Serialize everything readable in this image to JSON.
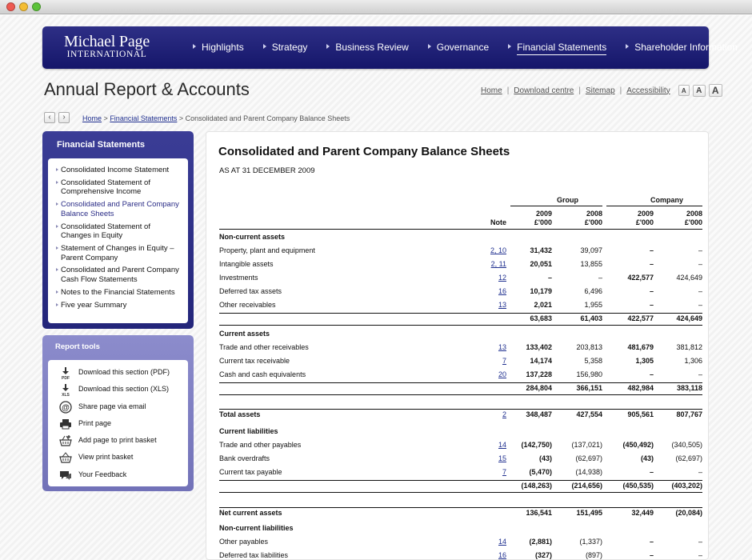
{
  "window": {
    "controls": [
      "close",
      "minimize",
      "zoom"
    ]
  },
  "logo": {
    "line1": "Michael Page",
    "line2": "INTERNATIONAL"
  },
  "nav": [
    {
      "label": "Highlights",
      "active": false
    },
    {
      "label": "Strategy",
      "active": false
    },
    {
      "label": "Business Review",
      "active": false
    },
    {
      "label": "Governance",
      "active": false
    },
    {
      "label": "Financial Statements",
      "active": true
    },
    {
      "label": "Shareholder Information",
      "active": false
    }
  ],
  "page_title": "Annual Report & Accounts",
  "util_links": [
    "Home",
    "Download centre",
    "Sitemap",
    "Accessibility"
  ],
  "font_sizes": [
    "A",
    "A",
    "A"
  ],
  "breadcrumb": {
    "home": "Home",
    "section": "Financial Statements",
    "current": "> Consolidated and Parent Company Balance Sheets",
    "sep": ">"
  },
  "sidebar": {
    "title": "Financial Statements",
    "items": [
      {
        "label": "Consolidated Income Statement",
        "active": false
      },
      {
        "label": "Consolidated Statement of Comprehensive Income",
        "active": false
      },
      {
        "label": "Consolidated and Parent Company Balance Sheets",
        "active": true
      },
      {
        "label": "Consolidated Statement of Changes in Equity",
        "active": false
      },
      {
        "label": "Statement of Changes in Equity – Parent Company",
        "active": false
      },
      {
        "label": "Consolidated and Parent Company Cash Flow Statements",
        "active": false
      },
      {
        "label": "Notes to the Financial Statements",
        "active": false
      },
      {
        "label": "Five year Summary",
        "active": false
      }
    ]
  },
  "tools": {
    "title": "Report tools",
    "items": [
      {
        "label": "Download this section (PDF)",
        "icon": "download-pdf-icon",
        "sub": "PDF"
      },
      {
        "label": "Download this section (XLS)",
        "icon": "download-xls-icon",
        "sub": "XLS"
      },
      {
        "label": "Share page via email",
        "icon": "email-icon"
      },
      {
        "label": "Print page",
        "icon": "printer-icon"
      },
      {
        "label": "Add page to print basket",
        "icon": "add-basket-icon"
      },
      {
        "label": "View print basket",
        "icon": "basket-icon"
      },
      {
        "label": "Your Feedback",
        "icon": "feedback-icon"
      }
    ]
  },
  "content": {
    "title": "Consolidated and Parent Company Balance Sheets",
    "subtitle": "AS AT 31 DECEMBER 2009",
    "group_label": "Group",
    "company_label": "Company",
    "note_header": "Note",
    "col_years": [
      "2009",
      "2008",
      "2009",
      "2008"
    ],
    "col_units": [
      "£'000",
      "£'000",
      "£'000",
      "£'000"
    ],
    "rows": [
      {
        "type": "section",
        "label": "Non-current assets"
      },
      {
        "type": "row",
        "label": "Property, plant and equipment",
        "note": "2, 10",
        "values": [
          "31,432",
          "39,097",
          "–",
          "–"
        ]
      },
      {
        "type": "row",
        "label": "Intangible assets",
        "note": "2, 11",
        "values": [
          "20,051",
          "13,855",
          "–",
          "–"
        ]
      },
      {
        "type": "row",
        "label": "Investments",
        "note": "12",
        "values": [
          "–",
          "–",
          "422,577",
          "424,649"
        ]
      },
      {
        "type": "row",
        "label": "Deferred tax assets",
        "note": "16",
        "values": [
          "10,179",
          "6,496",
          "–",
          "–"
        ]
      },
      {
        "type": "row",
        "label": "Other receivables",
        "note": "13",
        "values": [
          "2,021",
          "1,955",
          "–",
          "–"
        ]
      },
      {
        "type": "total",
        "label": "",
        "note": "",
        "values": [
          "63,683",
          "61,403",
          "422,577",
          "424,649"
        ]
      },
      {
        "type": "section",
        "label": "Current assets"
      },
      {
        "type": "row",
        "label": "Trade and other receivables",
        "note": "13",
        "values": [
          "133,402",
          "203,813",
          "481,679",
          "381,812"
        ]
      },
      {
        "type": "row",
        "label": "Current tax receivable",
        "note": "7",
        "values": [
          "14,174",
          "5,358",
          "1,305",
          "1,306"
        ]
      },
      {
        "type": "row",
        "label": "Cash and cash equivalents",
        "note": "20",
        "values": [
          "137,228",
          "156,980",
          "–",
          "–"
        ]
      },
      {
        "type": "total",
        "label": "",
        "note": "",
        "values": [
          "284,804",
          "366,151",
          "482,984",
          "383,118"
        ]
      },
      {
        "type": "grand",
        "label": "Total assets",
        "note": "2",
        "values": [
          "348,487",
          "427,554",
          "905,561",
          "807,767"
        ]
      },
      {
        "type": "section",
        "label": "Current liabilities"
      },
      {
        "type": "row",
        "label": "Trade and other payables",
        "note": "14",
        "values": [
          "(142,750)",
          "(137,021)",
          "(450,492)",
          "(340,505)"
        ]
      },
      {
        "type": "row",
        "label": "Bank overdrafts",
        "note": "15",
        "values": [
          "(43)",
          "(62,697)",
          "(43)",
          "(62,697)"
        ]
      },
      {
        "type": "row",
        "label": "Current tax payable",
        "note": "7",
        "values": [
          "(5,470)",
          "(14,938)",
          "–",
          "–"
        ]
      },
      {
        "type": "total",
        "label": "",
        "note": "",
        "values": [
          "(148,263)",
          "(214,656)",
          "(450,535)",
          "(403,202)"
        ]
      },
      {
        "type": "grand",
        "label": "Net current assets",
        "note": "",
        "values": [
          "136,541",
          "151,495",
          "32,449",
          "(20,084)"
        ]
      },
      {
        "type": "section",
        "label": "Non-current liabilities"
      },
      {
        "type": "row",
        "label": "Other payables",
        "note": "14",
        "values": [
          "(2,881)",
          "(1,337)",
          "–",
          "–"
        ]
      },
      {
        "type": "row",
        "label": "Deferred tax liabilities",
        "note": "16",
        "values": [
          "(327)",
          "(897)",
          "–",
          "–"
        ]
      }
    ]
  }
}
